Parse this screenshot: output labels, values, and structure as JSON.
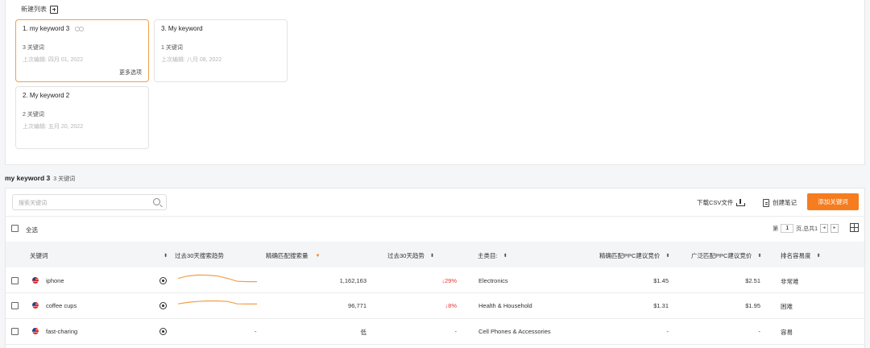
{
  "lists": {
    "new_list_label": "新建列表",
    "cards": [
      {
        "title": "1. my keyword 3",
        "count": "3 关键词",
        "edited": "上次编辑: 四月 01, 2022",
        "more": "更多选项",
        "shared": true,
        "active": true
      },
      {
        "title": "3. My keyword",
        "count": "1 关键词",
        "edited": "上次编辑: 八月 08, 2022"
      },
      {
        "title": "2. My keyword 2",
        "count": "2 关键词",
        "edited": "上次编辑: 五月 20, 2022"
      }
    ]
  },
  "section": {
    "title": "my keyword 3",
    "count": "3 关键词"
  },
  "toolbar": {
    "search_placeholder": "搜索关键词",
    "download_label": "下载CSV文件",
    "note_label": "创建笔记",
    "add_label": "添加关键词"
  },
  "selection": {
    "select_all": "全选"
  },
  "pager": {
    "prefix": "第",
    "page": "1",
    "suffix": "页,总共1"
  },
  "columns": {
    "keyword": "关键词",
    "trend_chart": "过去30天搜索趋势",
    "exact_volume": "精确匹配搜索量",
    "trend_30": "过去30天趋势",
    "category": "主类目:",
    "exact_ppc": "精确匹配PPC建议竞价",
    "broad_ppc": "广泛匹配PPC建议竞价",
    "difficulty": "排名容易度"
  },
  "rows": [
    {
      "keyword": "iphone",
      "volume": "1,162,163",
      "trend": "29%",
      "trend_dir": "down",
      "category": "Electronics",
      "exact_ppc": "$1.45",
      "broad_ppc": "$2.51",
      "difficulty": "非常难",
      "sparkline": [
        0.55,
        0.3,
        0.2,
        0.22,
        0.3,
        0.55,
        0.85,
        0.88,
        0.88
      ]
    },
    {
      "keyword": "coffee cups",
      "volume": "96,771",
      "trend": "8%",
      "trend_dir": "down",
      "category": "Health & Household",
      "exact_ppc": "$1.31",
      "broad_ppc": "$1.95",
      "difficulty": "困难",
      "sparkline": [
        0.6,
        0.45,
        0.35,
        0.3,
        0.3,
        0.35,
        0.6,
        0.62,
        0.62
      ]
    },
    {
      "keyword": "fast-charing",
      "trend_dash": "-",
      "volume": "低",
      "trend": "-",
      "category": "Cell Phones & Accessories",
      "exact_ppc": "-",
      "broad_ppc": "-",
      "difficulty": "容易"
    }
  ],
  "colors": {
    "accent": "#f57c1f",
    "trend_down": "#e53935",
    "sparkline": "#f0a04a"
  }
}
